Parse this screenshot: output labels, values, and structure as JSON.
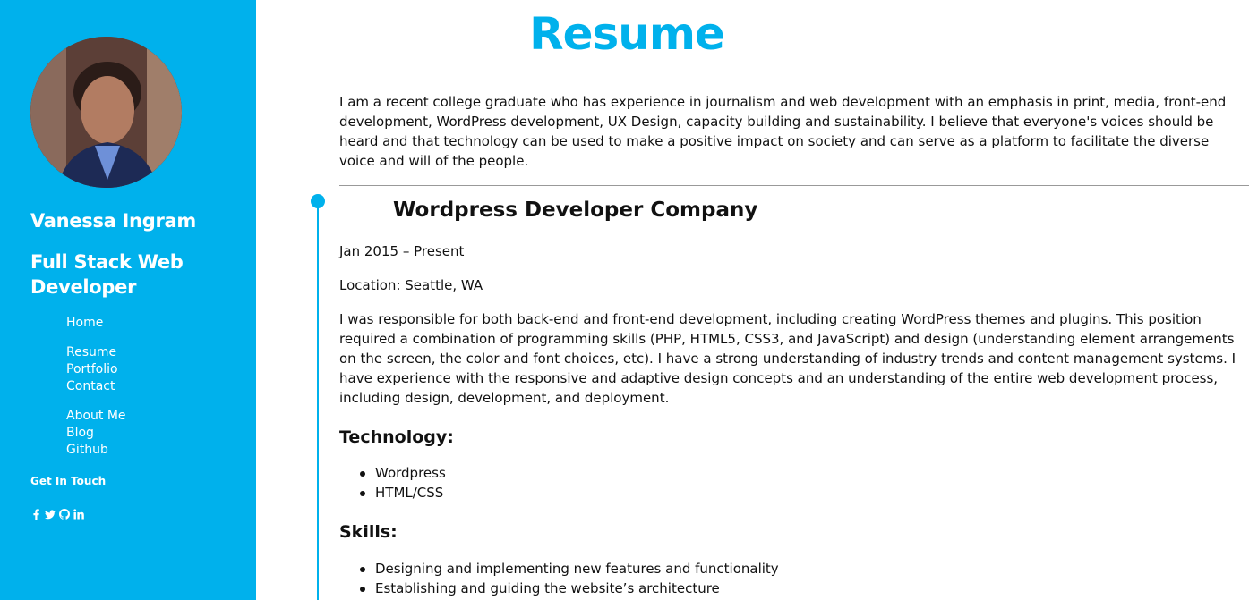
{
  "sidebar": {
    "name": "Vanessa Ingram",
    "role": "Full Stack Web Developer",
    "nav_primary": [
      {
        "label": "Home"
      }
    ],
    "nav_secondary": [
      {
        "label": "Resume"
      },
      {
        "label": "Portfolio"
      },
      {
        "label": "Contact"
      }
    ],
    "nav_tertiary": [
      {
        "label": "About Me"
      },
      {
        "label": "Blog"
      },
      {
        "label": "Github"
      }
    ],
    "get_in_touch": "Get In Touch",
    "social_icons": [
      "facebook-icon",
      "twitter-icon",
      "github-icon",
      "linkedin-icon"
    ],
    "bg_color": "#00b1ec"
  },
  "main": {
    "title": "Resume",
    "intro": "I am a recent college graduate who has experience in journalism and web development with an emphasis in print, media, front-end development, WordPress development, UX Design, capacity building and sustainability. I believe that everyone's voices should be heard and that technology can be used to make a positive impact on society and can serve as a platform to facilitate the diverse voice and will of the people.",
    "job": {
      "title": "Wordpress Developer Company",
      "dates": "Jan 2015 – Present",
      "location": "Location: Seattle, WA",
      "description": "I was responsible for both back-end and front-end development, including creating WordPress themes and plugins. This position required a combination of programming skills (PHP, HTML5, CSS3, and JavaScript) and design (understanding element arrangements on the screen, the color and font choices, etc). I have a strong understanding of industry trends and content management systems. I have experience with the responsive and adaptive design concepts and an understanding of the entire web development process, including design, development, and deployment.",
      "technology_heading": "Technology:",
      "technology": [
        "Wordpress",
        "HTML/CSS"
      ],
      "skills_heading": "Skills:",
      "skills": [
        "Designing and implementing new features and functionality",
        "Establishing and guiding the website’s architecture"
      ]
    },
    "accent_color": "#00b1ec"
  }
}
